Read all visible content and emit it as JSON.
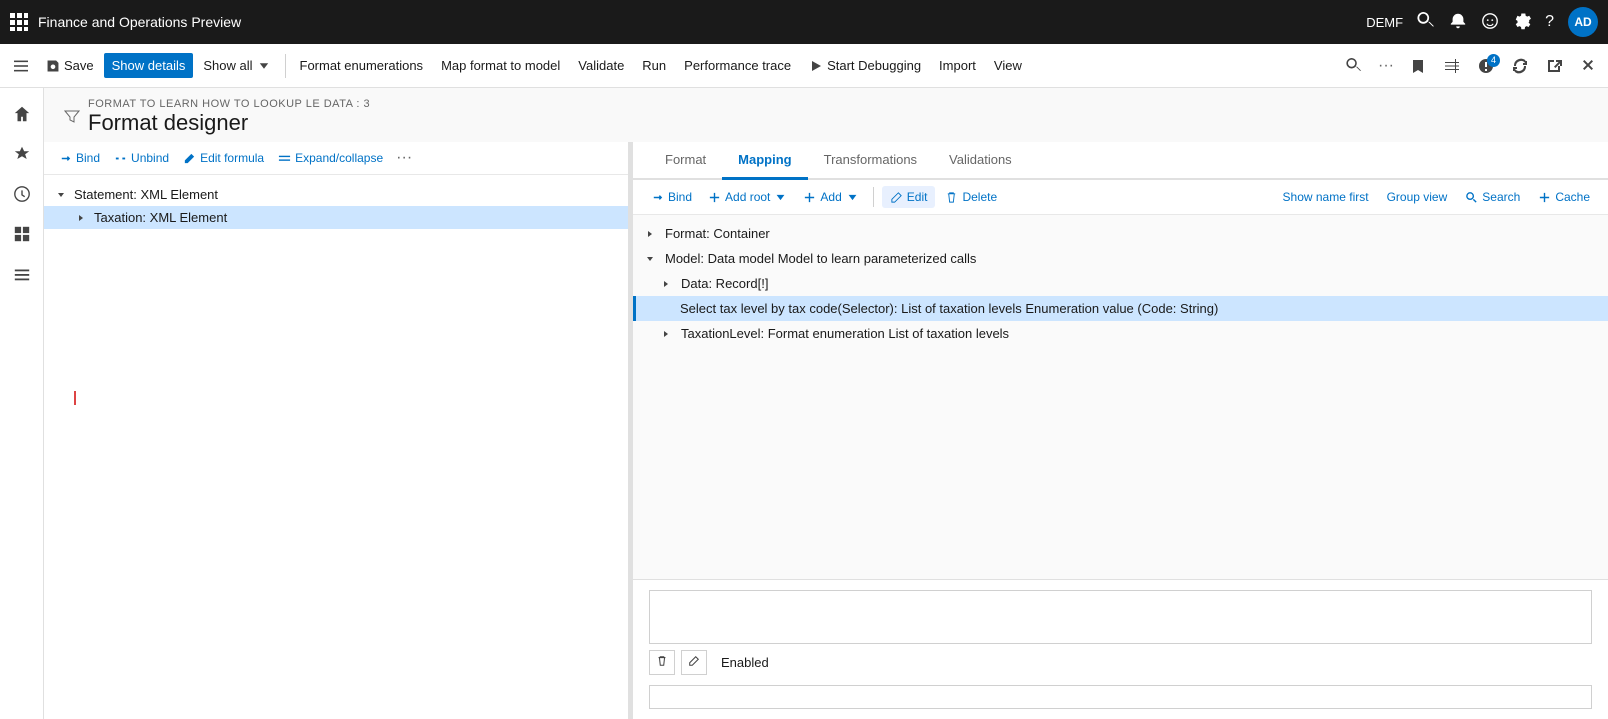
{
  "app": {
    "title": "Finance and Operations Preview",
    "user": "DEMF",
    "avatar": "AD"
  },
  "toolbar": {
    "save": "Save",
    "show_details": "Show details",
    "show_all": "Show all",
    "format_enumerations": "Format enumerations",
    "map_format_to_model": "Map format to model",
    "validate": "Validate",
    "run": "Run",
    "performance_trace": "Performance trace",
    "start_debugging": "Start Debugging",
    "import": "Import",
    "view": "View"
  },
  "page": {
    "breadcrumb": "FORMAT TO LEARN HOW TO LOOKUP LE DATA : 3",
    "title": "Format designer"
  },
  "left_toolbar": {
    "bind": "Bind",
    "unbind": "Unbind",
    "edit_formula": "Edit formula",
    "expand_collapse": "Expand/collapse"
  },
  "left_tree": {
    "items": [
      {
        "label": "Statement: XML Element",
        "indent": 0,
        "expanded": true,
        "selected": false
      },
      {
        "label": "Taxation: XML Element",
        "indent": 1,
        "expanded": false,
        "selected": true
      }
    ]
  },
  "tabs": [
    {
      "label": "Format",
      "active": false
    },
    {
      "label": "Mapping",
      "active": true
    },
    {
      "label": "Transformations",
      "active": false
    },
    {
      "label": "Validations",
      "active": false
    }
  ],
  "mapping_toolbar": {
    "bind": "Bind",
    "add_root": "Add root",
    "add": "Add",
    "edit": "Edit",
    "delete": "Delete",
    "show_name_first": "Show name first",
    "group_view": "Group view",
    "search": "Search",
    "cache": "Cache"
  },
  "mapping_tree": {
    "items": [
      {
        "label": "Format: Container",
        "indent": 0,
        "expanded": false
      },
      {
        "label": "Model: Data model Model to learn parameterized calls",
        "indent": 0,
        "expanded": true
      },
      {
        "label": "Data: Record[!]",
        "indent": 1,
        "expanded": false
      },
      {
        "label": "Select tax level by tax code(Selector): List of taxation levels Enumeration value (Code: String)",
        "indent": 2,
        "selected": true
      },
      {
        "label": "TaxationLevel: Format enumeration List of taxation levels",
        "indent": 1,
        "expanded": false
      }
    ]
  },
  "bottom": {
    "enabled_label": "Enabled",
    "formula_placeholder": ""
  }
}
